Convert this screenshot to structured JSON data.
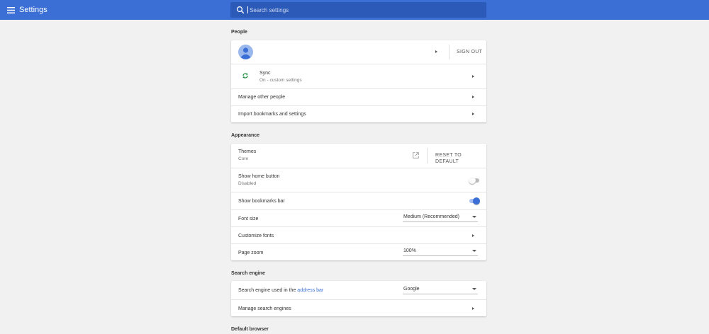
{
  "header": {
    "title": "Settings",
    "search_placeholder": "Search settings",
    "accent_color": "#3b6fd6"
  },
  "people": {
    "title": "People",
    "sign_out_label": "SIGN OUT",
    "sync_label": "Sync",
    "sync_status": "On - custom settings",
    "manage_people_label": "Manage other people",
    "import_label": "Import bookmarks and settings"
  },
  "appearance": {
    "title": "Appearance",
    "themes_label": "Themes",
    "themes_value": "Core",
    "reset_label": "RESET TO DEFAULT",
    "home_button_label": "Show home button",
    "home_button_status": "Disabled",
    "home_button_enabled": false,
    "bookmarks_bar_label": "Show bookmarks bar",
    "bookmarks_bar_enabled": true,
    "font_size_label": "Font size",
    "font_size_value": "Medium (Recommended)",
    "customize_fonts_label": "Customize fonts",
    "page_zoom_label": "Page zoom",
    "page_zoom_value": "100%"
  },
  "search_engine": {
    "title": "Search engine",
    "used_label_prefix": "Search engine used in the",
    "address_bar_link": "address bar",
    "engine_value": "Google",
    "manage_label": "Manage search engines"
  },
  "default_browser": {
    "title": "Default browser"
  }
}
